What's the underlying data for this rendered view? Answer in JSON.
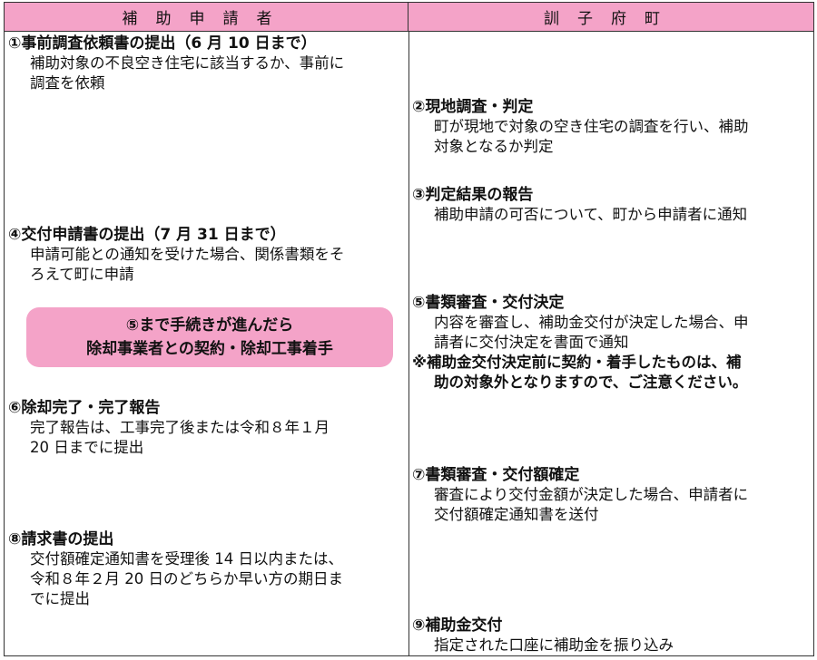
{
  "header": {
    "left": "補助申請者",
    "right": "訓子府町"
  },
  "left_steps": [
    {
      "title": "①事前調査依頼書の提出（6 月 10 日まで）",
      "lines": [
        "補助対象の不良空き住宅に該当するか、事前に",
        "調査を依頼"
      ]
    },
    {
      "title": "④交付申請書の提出（7 月 31 日まで）",
      "lines": [
        "申請可能との通知を受けた場合、関係書類をそ",
        "ろえて町に申請"
      ]
    },
    {
      "title": "⑥除却完了・完了報告",
      "lines": [
        "完了報告は、工事完了後または令和８年１月",
        "20 日までに提出"
      ]
    },
    {
      "title": "⑧請求書の提出",
      "lines": [
        "交付額確定通知書を受理後 14 日以内または、",
        "令和８年２月 20 日のどちらか早い方の期日ま",
        "でに提出"
      ]
    }
  ],
  "banner": {
    "line1": "⑤まで手続きが進んだら",
    "line2": "除却事業者との契約・除却工事着手"
  },
  "right_steps": [
    {
      "title": "②現地調査・判定",
      "lines": [
        "町が現地で対象の空き住宅の調査を行い、補助",
        "対象となるか判定"
      ]
    },
    {
      "title": "③判定結果の報告",
      "lines": [
        "補助申請の可否について、町から申請者に通知"
      ]
    },
    {
      "title": "⑤書類審査・交付決定",
      "lines": [
        "内容を審査し、補助金交付が決定した場合、申",
        "請者に交付決定を書面で通知"
      ],
      "note": [
        "※補助金交付決定前に契約・着手したものは、補",
        "助の対象外となりますので、ご注意ください。"
      ]
    },
    {
      "title": "⑦書類審査・交付額確定",
      "lines": [
        "審査により交付金額が決定した場合、申請者に",
        "交付額確定通知書を送付"
      ]
    },
    {
      "title": "⑨補助金交付",
      "lines": [
        "指定された口座に補助金を振り込み"
      ]
    }
  ]
}
